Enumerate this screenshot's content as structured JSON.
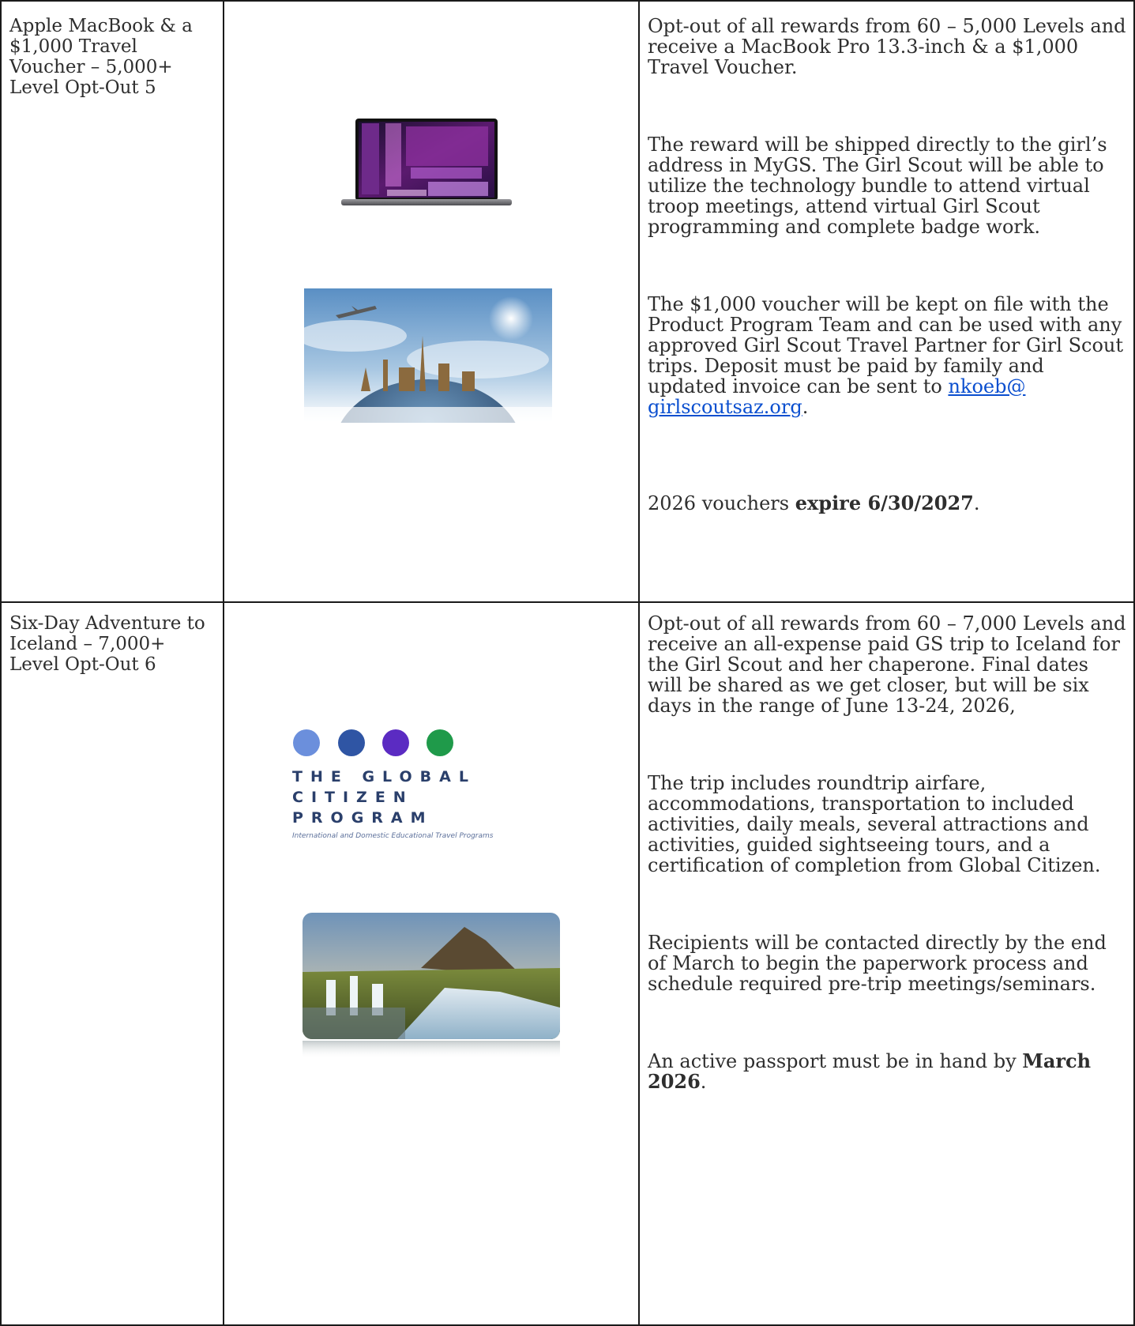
{
  "colors": {
    "link": "#0b4fcf",
    "border": "#1a1a1a",
    "text": "#2e2e2e"
  },
  "rows": [
    {
      "name": "Apple MacBook & a $1,000 Travel Voucher – 5,000+ Level Opt-Out 5",
      "images": [
        "macbook-laptop-photo",
        "globe-landmarks-travel-photo"
      ],
      "p1": "Opt-out of all rewards from 60 – 5,000 Levels and receive a MacBook Pro 13.3-inch & a $1,000 Travel Voucher.",
      "p2": "The reward will be shipped directly to the girl’s address in MyGS.  The Girl Scout will be able to utilize the technology bundle to attend virtual troop meetings, attend virtual Girl Scout programming and complete badge work.",
      "p3_before": "The $1,000 voucher will be kept on file with the Product Program Team and can be used with any approved Girl Scout Travel Partner for Girl Scout trips. Deposit must be paid by family and updated invoice can be sent to ",
      "p3_link": "nkoeb@ girlscoutsaz.org",
      "p3_after": ".",
      "p4_before": "2026 vouchers ",
      "p4_bold": "expire 6/30/2027",
      "p4_after": "."
    },
    {
      "name": "Six-Day Adventure to Iceland – 7,000+ Level Opt-Out 6",
      "logo": {
        "title_line1": "THE GLOBAL CITIZEN",
        "title_line2": "PROGRAM",
        "tagline": "International and Domestic Educational Travel Programs",
        "dots": [
          "#6b8fdc",
          "#2f55a4",
          "#5b2bc2",
          "#1f9a4a"
        ]
      },
      "images": [
        "iceland-waterfall-mountain-photo"
      ],
      "p1": "Opt-out of all rewards from 60 – 7,000 Levels and receive an all-expense paid GS trip to Iceland for the Girl Scout and her chaperone.  Final dates will be shared as we get closer, but will be six days in the range of June 13-24, 2026,",
      "p2": "The trip includes roundtrip airfare, accommodations, transportation to included activities, daily meals, several attractions and activities, guided sightseeing tours, and a certification of completion from Global Citizen.",
      "p3": "Recipients will be contacted directly by the end of March to begin the paperwork process and schedule required pre-trip meetings/seminars.",
      "p4_before": "An active passport must be in hand by ",
      "p4_bold": "March 2026",
      "p4_after": "."
    }
  ]
}
